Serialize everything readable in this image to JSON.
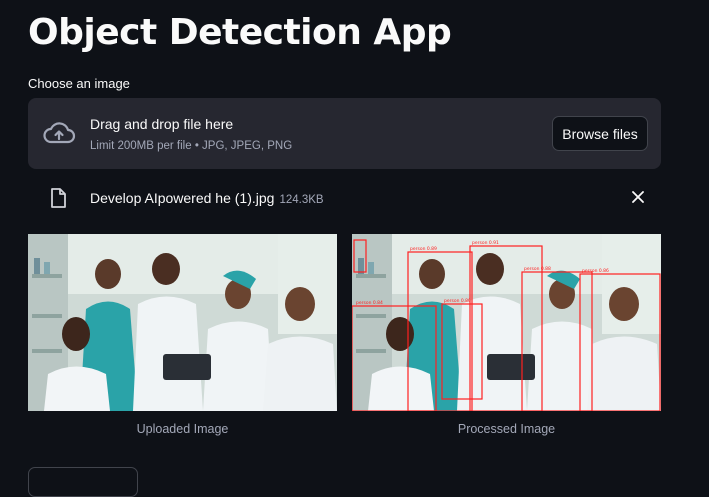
{
  "app": {
    "title": "Object Detection App"
  },
  "uploader": {
    "label": "Choose an image",
    "drag_text": "Drag and drop file here",
    "limit_text": "Limit 200MB per file • JPG, JPEG, PNG",
    "browse_label": "Browse files",
    "icon": "cloud-upload-icon"
  },
  "file": {
    "name": "Develop AIpowered he (1).jpg",
    "size": "124.3KB",
    "icon": "file-icon",
    "remove_icon": "close-icon"
  },
  "images": {
    "uploaded_caption": "Uploaded Image",
    "processed_caption": "Processed Image",
    "detections": [
      {
        "label": "person 0.89"
      },
      {
        "label": "person 0.91"
      },
      {
        "label": "person 0.88"
      },
      {
        "label": "person 0.86"
      },
      {
        "label": "person 0.84"
      },
      {
        "label": "person 0.80"
      }
    ]
  },
  "colors": {
    "background": "#0e1117",
    "panel": "#262730",
    "text": "#fafafa",
    "muted": "#a3a8b8",
    "detection": "#ff2020"
  }
}
